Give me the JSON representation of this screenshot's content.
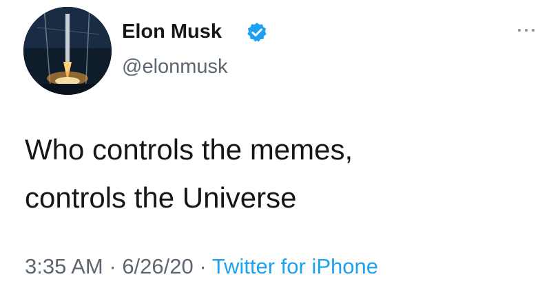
{
  "user": {
    "display_name": "Elon Musk",
    "handle": "@elonmusk",
    "verified_icon": "verified-badge-icon",
    "avatar_icon": "rocket-launch-avatar"
  },
  "tweet": {
    "lines": [
      "Who controls the memes,",
      "controls the Universe"
    ]
  },
  "meta": {
    "time": "3:35 AM",
    "separator": " · ",
    "date": "6/26/20",
    "source": "Twitter for iPhone"
  },
  "more_icon": "more-dots-icon",
  "colors": {
    "accent": "#1da1f2",
    "text": "#14171a",
    "muted": "#5b6670"
  }
}
